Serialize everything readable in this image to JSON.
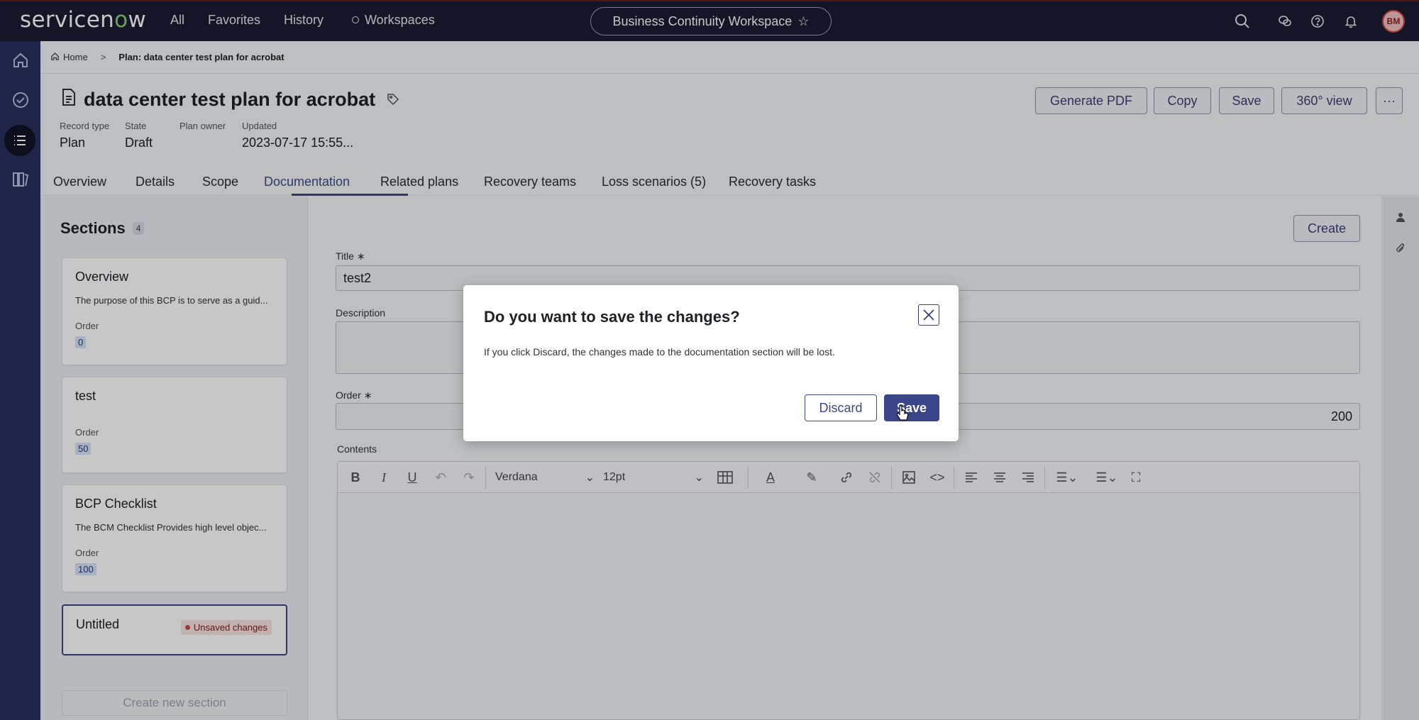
{
  "topnav": {
    "logo_prefix": "servicen",
    "logo_o": "o",
    "logo_suffix": "w",
    "links": [
      "All",
      "Favorites",
      "History",
      "Workspaces"
    ],
    "workspace_pill": "Business Continuity Workspace",
    "avatar_initials": "BM"
  },
  "breadcrumb": {
    "home": "Home",
    "sep": ">",
    "current": "Plan: data center test plan for acrobat"
  },
  "record": {
    "title": "data center test plan for acrobat",
    "meta": [
      {
        "label": "Record type",
        "value": "Plan"
      },
      {
        "label": "State",
        "value": "Draft"
      },
      {
        "label": "Plan owner",
        "value": ""
      },
      {
        "label": "Updated",
        "value": "2023-07-17 15:55..."
      }
    ],
    "buttons": {
      "generate_pdf": "Generate PDF",
      "copy": "Copy",
      "save": "Save",
      "view360": "360° view",
      "more": "···"
    }
  },
  "tabs": [
    "Overview",
    "Details",
    "Scope",
    "Documentation",
    "Related plans",
    "Recovery teams",
    "Loss scenarios (5)",
    "Recovery tasks"
  ],
  "sections": {
    "heading": "Sections",
    "count": "4",
    "order_label": "Order",
    "cards": [
      {
        "title": "Overview",
        "desc": "The purpose of this BCP is to serve as a guid...",
        "order": "0"
      },
      {
        "title": "test",
        "desc": "",
        "order": "50"
      },
      {
        "title": "BCP Checklist",
        "desc": "The BCM Checklist Provides high level objec...",
        "order": "100"
      }
    ],
    "selected": {
      "title": "Untitled",
      "badge": "Unsaved changes"
    },
    "create_new": "Create new section"
  },
  "form": {
    "create": "Create",
    "title_label": "Title",
    "title_value": "test2",
    "description_label": "Description",
    "order_label": "Order",
    "order_value": "200",
    "contents_label": "Contents",
    "required_mark": "∗",
    "toolbar": {
      "font": "Verdana",
      "size": "12pt"
    }
  },
  "modal": {
    "title": "Do you want to save the changes?",
    "body": "If you click Discard, the changes made to the documentation section will be lost.",
    "discard": "Discard",
    "save": "Save"
  }
}
